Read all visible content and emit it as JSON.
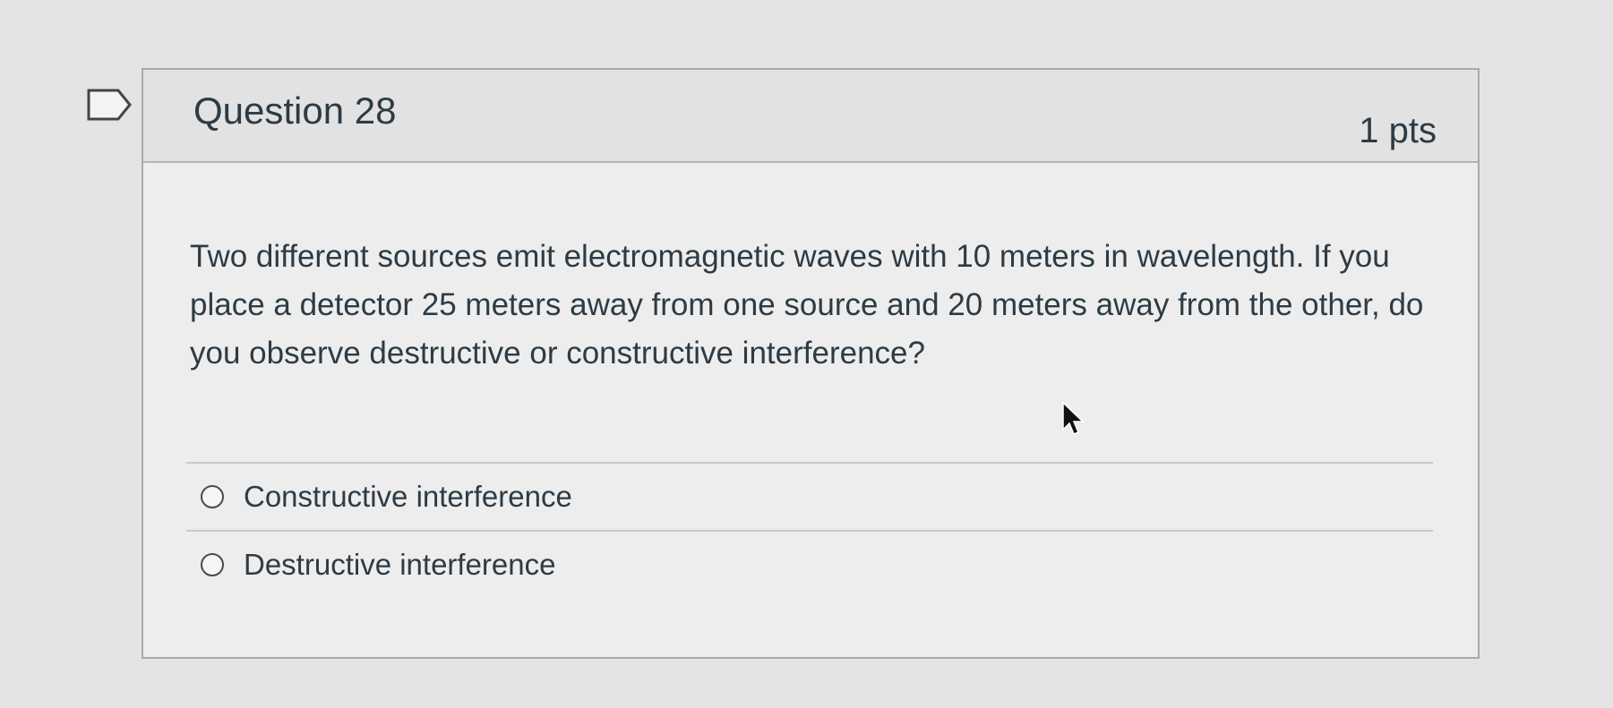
{
  "question": {
    "title": "Question 28",
    "points": "1 pts",
    "text": "Two different sources emit electromagnetic waves with 10 meters in wavelength. If you place a detector 25 meters away from one source and 20 meters away from the other, do you observe destructive or constructive interference?"
  },
  "answers": [
    {
      "label": "Constructive interference",
      "selected": false
    },
    {
      "label": "Destructive interference",
      "selected": false
    }
  ],
  "icons": {
    "flag": "flag-question-icon",
    "cursor": "mouse-pointer-icon"
  },
  "colors": {
    "text": "#2d3b45",
    "header_bg": "#e2e2e2",
    "card_bg": "#ededed",
    "page_bg": "#e4e4e4"
  }
}
